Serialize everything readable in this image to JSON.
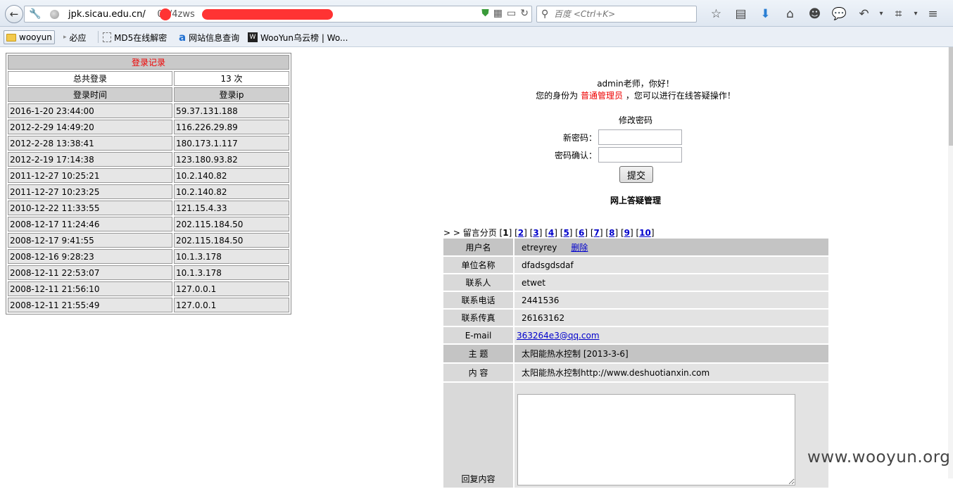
{
  "browser": {
    "url_host": "jpk.sicau.edu.cn/",
    "url_path_visible": "07/4zws",
    "search_placeholder": "百度 <Ctrl+K>"
  },
  "bookmarks": {
    "folder": "wooyun",
    "items": [
      "必应",
      "MD5在线解密",
      "网站信息查询",
      "WooYun乌云榜 | Wo..."
    ]
  },
  "login_table": {
    "title": "登录记录",
    "total_label": "总共登录",
    "total_value": "13  次",
    "headers": [
      "登录时间",
      "登录ip"
    ],
    "rows": [
      [
        "2016-1-20 23:44:00",
        "59.37.131.188"
      ],
      [
        "2012-2-29 14:49:20",
        "116.226.29.89"
      ],
      [
        "2012-2-28 13:38:41",
        "180.173.1.117"
      ],
      [
        "2012-2-19 17:14:38",
        "123.180.93.82"
      ],
      [
        "2011-12-27 10:25:21",
        "10.2.140.82"
      ],
      [
        "2011-12-27 10:23:25",
        "10.2.140.82"
      ],
      [
        "2010-12-22 11:33:55",
        "121.15.4.33"
      ],
      [
        "2008-12-17 11:24:46",
        "202.115.184.50"
      ],
      [
        "2008-12-17 9:41:55",
        "202.115.184.50"
      ],
      [
        "2008-12-16 9:28:23",
        "10.1.3.178"
      ],
      [
        "2008-12-11 22:53:07",
        "10.1.3.178"
      ],
      [
        "2008-12-11 21:56:10",
        "127.0.0.1"
      ],
      [
        "2008-12-11 21:55:49",
        "127.0.0.1"
      ]
    ]
  },
  "admin": {
    "greeting": "admin老师，你好！",
    "role_prefix": "您的身份为 ",
    "role": "普通管理员",
    "role_suffix": " ，您可以进行在线答疑操作！",
    "change_pw_title": "修改密码",
    "new_pw_label": "新密码：",
    "confirm_pw_label": "密码确认：",
    "submit_label": "提交",
    "section_title": "网上答疑管理"
  },
  "pager": {
    "prefix": "> > 留言分页 [",
    "current": "1",
    "pages": [
      "2",
      "3",
      "4",
      "5",
      "6",
      "7",
      "8",
      "9",
      "10"
    ]
  },
  "message": {
    "fields": [
      {
        "label": "用户名",
        "value": "etreyrey"
      },
      {
        "label": "单位名称",
        "value": "dfadsgdsdaf"
      },
      {
        "label": "联系人",
        "value": "etwet"
      },
      {
        "label": "联系电话",
        "value": "2441536"
      },
      {
        "label": "联系传真",
        "value": "26163162"
      },
      {
        "label": "E-mail",
        "value": "363264e3@qq.com"
      },
      {
        "label": "主 题",
        "value": "太阳能热水控制  [2013-3-6]"
      },
      {
        "label": "内 容",
        "value": " 太阳能热水控制http://www.deshuotianxin.com"
      }
    ],
    "delete_label": "删除",
    "reply_label": "回复内容"
  },
  "watermark": "www.wooyun.org"
}
